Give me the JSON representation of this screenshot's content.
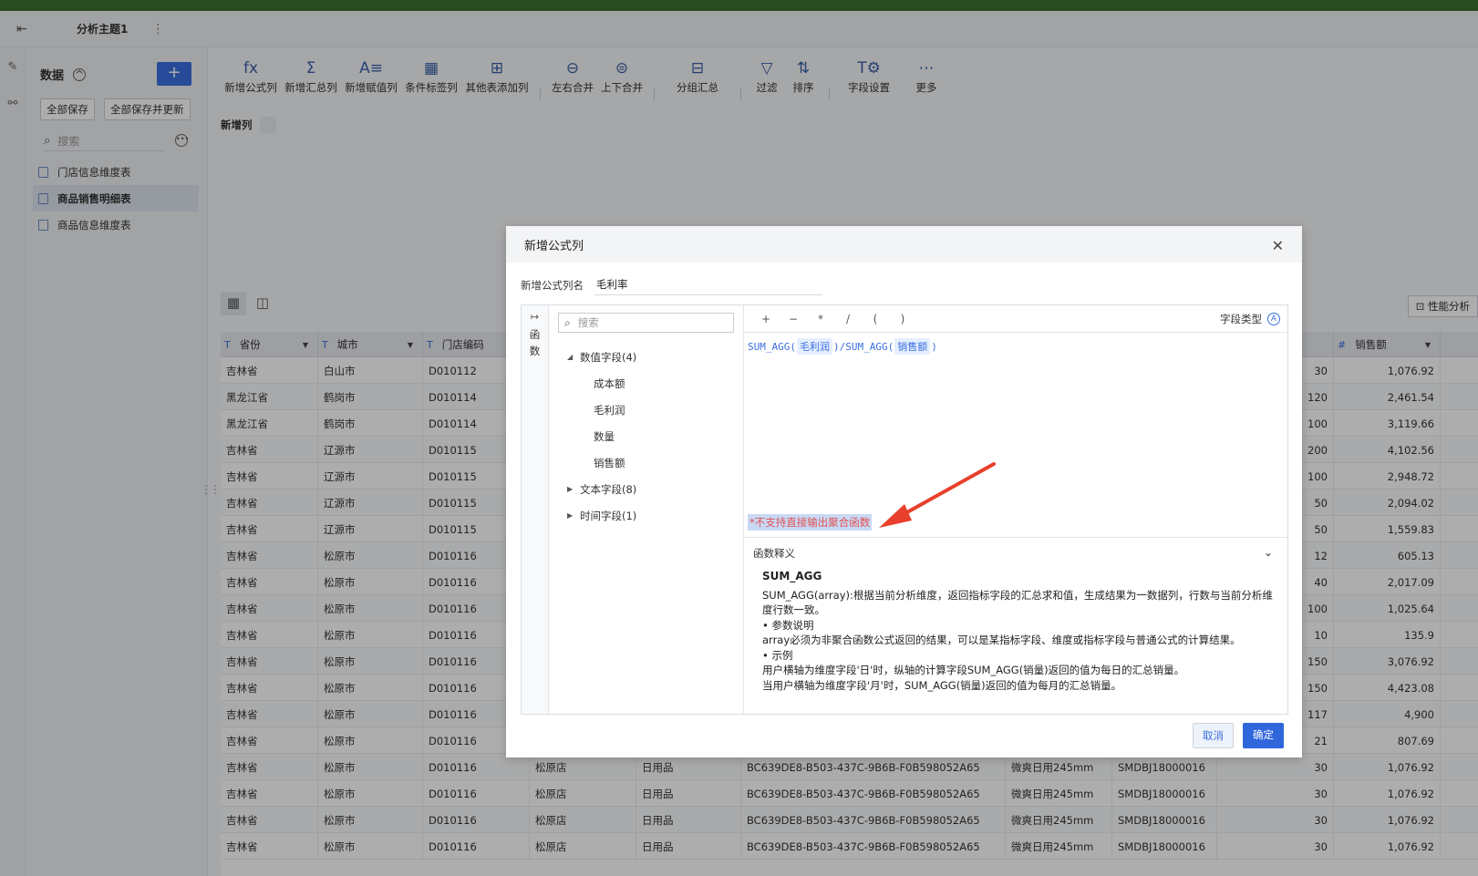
{
  "appbar": {
    "title": "分析主题1"
  },
  "left_panel": {
    "header": "数据",
    "add_label": "+",
    "save_all": "全部保存",
    "save_all_update": "全部保存并更新",
    "search_placeholder": "搜索",
    "tables": [
      "门店信息维度表",
      "商品销售明细表",
      "商品信息维度表"
    ]
  },
  "toolbar": {
    "items": [
      {
        "icon": "fx",
        "label": "新增公式列"
      },
      {
        "icon": "Σ",
        "label": "新增汇总列"
      },
      {
        "icon": "A≡",
        "label": "新增赋值列"
      },
      {
        "icon": "▦",
        "label": "条件标签列"
      },
      {
        "icon": "⊞",
        "label": "其他表添加列"
      },
      {
        "icon": "⊖",
        "label": "左右合并"
      },
      {
        "icon": "⊜",
        "label": "上下合并"
      },
      {
        "icon": "⊟",
        "label": "分组汇总"
      },
      {
        "icon": "▽",
        "label": "过滤"
      },
      {
        "icon": "⇅",
        "label": "排序"
      },
      {
        "icon": "T⚙",
        "label": "字段设置"
      },
      {
        "icon": "⋯",
        "label": "更多"
      }
    ]
  },
  "new_col_label": "新增列",
  "perf_label": "性能分析",
  "grid": {
    "headers": [
      "省份",
      "城市",
      "门店编码",
      "",
      "",
      "",
      "",
      "",
      "",
      "销售额"
    ],
    "rows": [
      [
        "吉林省",
        "白山市",
        "D010112",
        "",
        "",
        "",
        "",
        "",
        "30",
        "1,076.92"
      ],
      [
        "黑龙江省",
        "鹤岗市",
        "D010114",
        "",
        "",
        "",
        "",
        "",
        "120",
        "2,461.54"
      ],
      [
        "黑龙江省",
        "鹤岗市",
        "D010114",
        "",
        "",
        "",
        "",
        "",
        "100",
        "3,119.66"
      ],
      [
        "吉林省",
        "辽源市",
        "D010115",
        "",
        "",
        "",
        "",
        "",
        "200",
        "4,102.56"
      ],
      [
        "吉林省",
        "辽源市",
        "D010115",
        "",
        "",
        "",
        "",
        "",
        "100",
        "2,948.72"
      ],
      [
        "吉林省",
        "辽源市",
        "D010115",
        "",
        "",
        "",
        "",
        "",
        "50",
        "2,094.02"
      ],
      [
        "吉林省",
        "辽源市",
        "D010115",
        "",
        "",
        "",
        "",
        "",
        "50",
        "1,559.83"
      ],
      [
        "吉林省",
        "松原市",
        "D010116",
        "",
        "",
        "",
        "",
        "",
        "12",
        "605.13"
      ],
      [
        "吉林省",
        "松原市",
        "D010116",
        "",
        "",
        "",
        "",
        "",
        "40",
        "2,017.09"
      ],
      [
        "吉林省",
        "松原市",
        "D010116",
        "",
        "",
        "",
        "",
        "",
        "100",
        "1,025.64"
      ],
      [
        "吉林省",
        "松原市",
        "D010116",
        "",
        "",
        "",
        "",
        "",
        "10",
        "135.9"
      ],
      [
        "吉林省",
        "松原市",
        "D010116",
        "",
        "",
        "",
        "",
        "",
        "150",
        "3,076.92"
      ],
      [
        "吉林省",
        "松原市",
        "D010116",
        "",
        "",
        "",
        "",
        "",
        "150",
        "4,423.08"
      ],
      [
        "吉林省",
        "松原市",
        "D010116",
        "",
        "",
        "",
        "",
        "",
        "117",
        "4,900"
      ],
      [
        "吉林省",
        "松原市",
        "D010116",
        "",
        "",
        "",
        "",
        "",
        "21",
        "807.69"
      ],
      [
        "吉林省",
        "松原市",
        "D010116",
        "松原店",
        "日用品",
        "BC639DE8-B503-437C-9B6B-F0B598052A65",
        "微爽日用245mm",
        "SMDBJ18000016",
        "30",
        "1,076.92"
      ],
      [
        "吉林省",
        "松原市",
        "D010116",
        "松原店",
        "日用品",
        "BC639DE8-B503-437C-9B6B-F0B598052A65",
        "微爽日用245mm",
        "SMDBJ18000016",
        "30",
        "1,076.92"
      ],
      [
        "吉林省",
        "松原市",
        "D010116",
        "松原店",
        "日用品",
        "BC639DE8-B503-437C-9B6B-F0B598052A65",
        "微爽日用245mm",
        "SMDBJ18000016",
        "30",
        "1,076.92"
      ],
      [
        "吉林省",
        "松原市",
        "D010116",
        "松原店",
        "日用品",
        "BC639DE8-B503-437C-9B6B-F0B598052A65",
        "微爽日用245mm",
        "SMDBJ18000016",
        "30",
        "1,076.92"
      ]
    ]
  },
  "dialog": {
    "title": "新增公式列",
    "name_label": "新增公式列名",
    "name_value": "毛利率",
    "fn_rail": [
      "函",
      "数"
    ],
    "search_placeholder": "搜索",
    "tree": {
      "numeric_group": "数值字段(4)",
      "numeric_fields": [
        "成本额",
        "毛利润",
        "数量",
        "销售额"
      ],
      "text_group": "文本字段(8)",
      "time_group": "时间字段(1)"
    },
    "operators": [
      "+",
      "−",
      "*",
      "/",
      "(",
      ")"
    ],
    "field_type_label": "字段类型",
    "formula": {
      "fn1": "SUM_AGG(",
      "arg1": "毛利润",
      "mid": ")/SUM_AGG(",
      "arg2": "销售额",
      "end": ")"
    },
    "error": "*不支持直接输出聚合函数",
    "doc": {
      "header": "函数释义",
      "name": "SUM_AGG",
      "lines": [
        "SUM_AGG(array):根据当前分析维度，返回指标字段的汇总求和值，生成结果为一数据列，行数与当前分析维度行数一致。",
        "• 参数说明",
        "array必须为非聚合函数公式返回的结果，可以是某指标字段、维度或指标字段与普通公式的计算结果。",
        "• 示例",
        "用户横轴为维度字段'日'时，纵轴的计算字段SUM_AGG(销量)返回的值为每日的汇总销量。",
        "当用户横轴为维度字段'月'时，SUM_AGG(销量)返回的值为每月的汇总销量。"
      ]
    },
    "cancel": "取消",
    "ok": "确定"
  },
  "colors": {
    "accent": "#2f66db",
    "error": "#e25050",
    "topstrip": "#3f6e2e"
  }
}
